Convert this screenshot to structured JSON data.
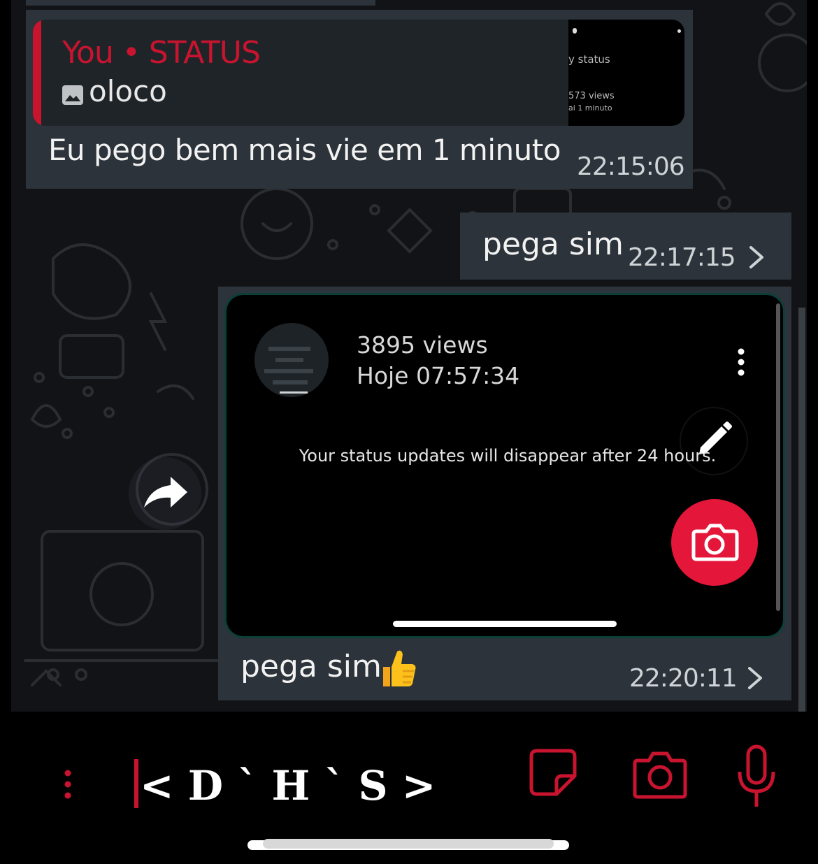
{
  "quoted_message": {
    "author": "You",
    "separator": "•",
    "source": "STATUS",
    "text": "oloco",
    "thumbnail_text_1": "y status",
    "thumbnail_text_2": "573 views",
    "thumbnail_text_3": "ai 1 minuto",
    "icon": "image-icon"
  },
  "messages": [
    {
      "text": "Eu pego bem mais vie em 1 minuto",
      "time": "22:15:06",
      "direction": "incoming"
    },
    {
      "text": "pega sim",
      "time": "22:17:15",
      "direction": "outgoing"
    },
    {
      "text": "pega sim",
      "emoji": "👍",
      "time": "22:20:11",
      "direction": "outgoing"
    }
  ],
  "screenshot": {
    "views": "3895 views",
    "date": "Hoje 07:57:34",
    "notice": "Your status updates will disappear after 24 hours."
  },
  "composer": {
    "typed_text": "< D ` H ` S >",
    "icons": [
      "menu-dots-icon",
      "sticker-icon",
      "camera-icon",
      "mic-icon"
    ]
  },
  "colors": {
    "accent": "#c8142f",
    "fab": "#e4163a",
    "bubble": "#2c333a",
    "chat_bg": "#121316"
  }
}
